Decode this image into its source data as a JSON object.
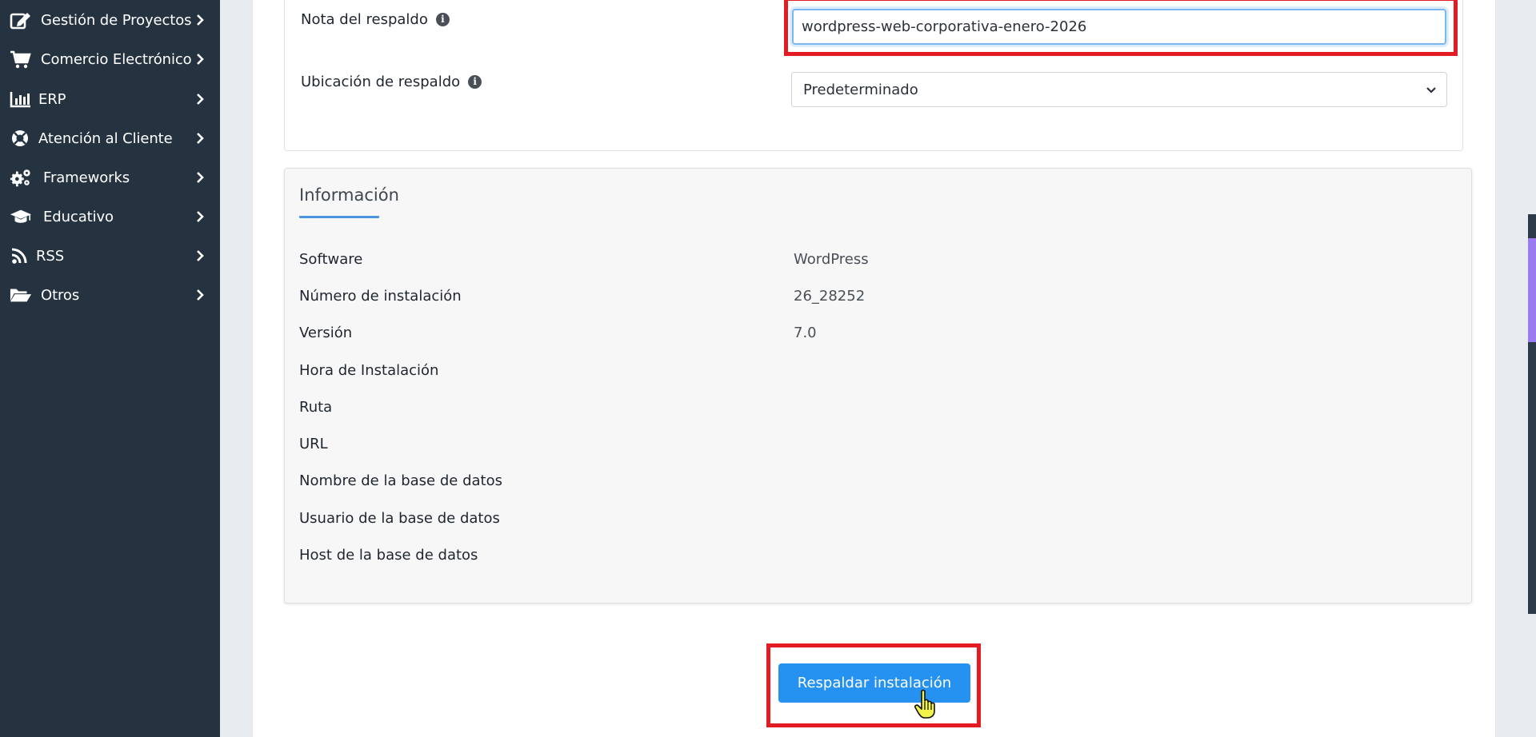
{
  "sidebar": {
    "items": [
      {
        "label": "Gestión de Proyectos",
        "icon": "edit-icon"
      },
      {
        "label": "Comercio Electrónico",
        "icon": "cart-icon"
      },
      {
        "label": "ERP",
        "icon": "chart-bar-icon"
      },
      {
        "label": "Atención al Cliente",
        "icon": "lifebuoy-icon"
      },
      {
        "label": "Frameworks",
        "icon": "cogs-icon"
      },
      {
        "label": "Educativo",
        "icon": "graduation-cap-icon"
      },
      {
        "label": "RSS",
        "icon": "rss-icon"
      },
      {
        "label": "Otros",
        "icon": "folder-open-icon"
      }
    ]
  },
  "form": {
    "note_label": "Nota del respaldo",
    "note_value": "wordpress-web-corporativa-enero-2026",
    "location_label": "Ubicación de respaldo",
    "location_selected": "Predeterminado"
  },
  "info": {
    "title": "Información",
    "rows": [
      {
        "label": "Software",
        "value": "WordPress"
      },
      {
        "label": "Número de instalación",
        "value": "26_28252"
      },
      {
        "label": "Versión",
        "value": "7.0"
      },
      {
        "label": "Hora de Instalación",
        "value": ""
      },
      {
        "label": "Ruta",
        "value": ""
      },
      {
        "label": "URL",
        "value": ""
      },
      {
        "label": "Nombre de la base de datos",
        "value": ""
      },
      {
        "label": "Usuario de la base de datos",
        "value": ""
      },
      {
        "label": "Host de la base de datos",
        "value": ""
      }
    ]
  },
  "actions": {
    "backup_button": "Respaldar instalación"
  },
  "colors": {
    "sidebar_bg": "#253341",
    "primary": "#2591f0",
    "highlight": "#e31b23"
  }
}
